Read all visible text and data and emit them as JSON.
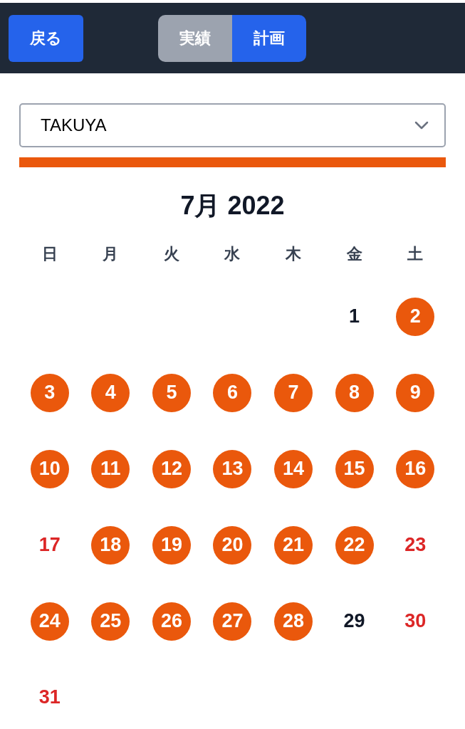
{
  "header": {
    "back_button": "戻る",
    "tabs": [
      {
        "label": "実績",
        "selected": false
      },
      {
        "label": "計画",
        "selected": true
      }
    ]
  },
  "user_select": {
    "value": "TAKUYA"
  },
  "calendar": {
    "title": "7月 2022",
    "weekdays": [
      "日",
      "月",
      "火",
      "水",
      "木",
      "金",
      "土"
    ],
    "weeks": [
      {
        "days": [
          {
            "label": "1",
            "kind": "plain"
          },
          {
            "label": "2",
            "kind": "marked"
          }
        ]
      },
      {
        "days": [
          {
            "label": "3",
            "kind": "marked"
          },
          {
            "label": "4",
            "kind": "marked"
          },
          {
            "label": "5",
            "kind": "marked"
          },
          {
            "label": "6",
            "kind": "marked"
          },
          {
            "label": "7",
            "kind": "marked"
          },
          {
            "label": "8",
            "kind": "marked"
          },
          {
            "label": "9",
            "kind": "marked"
          }
        ]
      },
      {
        "days": [
          {
            "label": "10",
            "kind": "marked"
          },
          {
            "label": "11",
            "kind": "marked"
          },
          {
            "label": "12",
            "kind": "marked"
          },
          {
            "label": "13",
            "kind": "marked"
          },
          {
            "label": "14",
            "kind": "marked"
          },
          {
            "label": "15",
            "kind": "marked"
          },
          {
            "label": "16",
            "kind": "marked"
          }
        ]
      },
      {
        "days": [
          {
            "label": "17",
            "kind": "holiday"
          },
          {
            "label": "18",
            "kind": "marked"
          },
          {
            "label": "19",
            "kind": "marked"
          },
          {
            "label": "20",
            "kind": "marked"
          },
          {
            "label": "21",
            "kind": "marked"
          },
          {
            "label": "22",
            "kind": "marked"
          },
          {
            "label": "23",
            "kind": "holiday"
          }
        ]
      },
      {
        "days": [
          {
            "label": "24",
            "kind": "marked"
          },
          {
            "label": "25",
            "kind": "marked"
          },
          {
            "label": "26",
            "kind": "marked"
          },
          {
            "label": "27",
            "kind": "marked"
          },
          {
            "label": "28",
            "kind": "marked"
          },
          {
            "label": "29",
            "kind": "plain"
          },
          {
            "label": "30",
            "kind": "holiday"
          }
        ]
      },
      {
        "days": [
          {
            "label": "31",
            "kind": "holiday"
          }
        ]
      }
    ]
  }
}
